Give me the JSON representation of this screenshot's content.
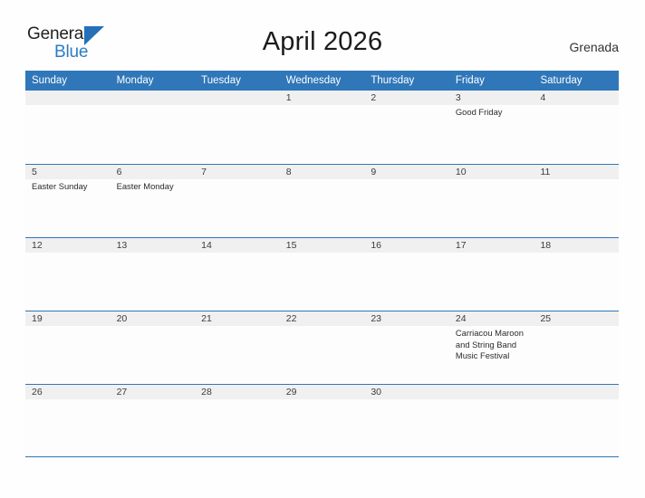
{
  "brand": {
    "word1": "General",
    "word2": "Blue",
    "triangle_color": "#2570b8",
    "accent_color": "#2b7cc4"
  },
  "header": {
    "title": "April 2026",
    "location": "Grenada"
  },
  "calendar": {
    "header_color": "#2f77b9",
    "day_strip_color": "#F0F0F0",
    "weekdays": [
      "Sunday",
      "Monday",
      "Tuesday",
      "Wednesday",
      "Thursday",
      "Friday",
      "Saturday"
    ],
    "weeks": [
      [
        {
          "day": "",
          "events": []
        },
        {
          "day": "",
          "events": []
        },
        {
          "day": "",
          "events": []
        },
        {
          "day": "1",
          "events": []
        },
        {
          "day": "2",
          "events": []
        },
        {
          "day": "3",
          "events": [
            "Good Friday"
          ]
        },
        {
          "day": "4",
          "events": []
        }
      ],
      [
        {
          "day": "5",
          "events": [
            "Easter Sunday"
          ]
        },
        {
          "day": "6",
          "events": [
            "Easter Monday"
          ]
        },
        {
          "day": "7",
          "events": []
        },
        {
          "day": "8",
          "events": []
        },
        {
          "day": "9",
          "events": []
        },
        {
          "day": "10",
          "events": []
        },
        {
          "day": "11",
          "events": []
        }
      ],
      [
        {
          "day": "12",
          "events": []
        },
        {
          "day": "13",
          "events": []
        },
        {
          "day": "14",
          "events": []
        },
        {
          "day": "15",
          "events": []
        },
        {
          "day": "16",
          "events": []
        },
        {
          "day": "17",
          "events": []
        },
        {
          "day": "18",
          "events": []
        }
      ],
      [
        {
          "day": "19",
          "events": []
        },
        {
          "day": "20",
          "events": []
        },
        {
          "day": "21",
          "events": []
        },
        {
          "day": "22",
          "events": []
        },
        {
          "day": "23",
          "events": []
        },
        {
          "day": "24",
          "events": [
            "Carriacou Maroon and String Band Music Festival"
          ]
        },
        {
          "day": "25",
          "events": []
        }
      ],
      [
        {
          "day": "26",
          "events": []
        },
        {
          "day": "27",
          "events": []
        },
        {
          "day": "28",
          "events": []
        },
        {
          "day": "29",
          "events": []
        },
        {
          "day": "30",
          "events": []
        },
        {
          "day": "",
          "events": []
        },
        {
          "day": "",
          "events": []
        }
      ]
    ]
  }
}
